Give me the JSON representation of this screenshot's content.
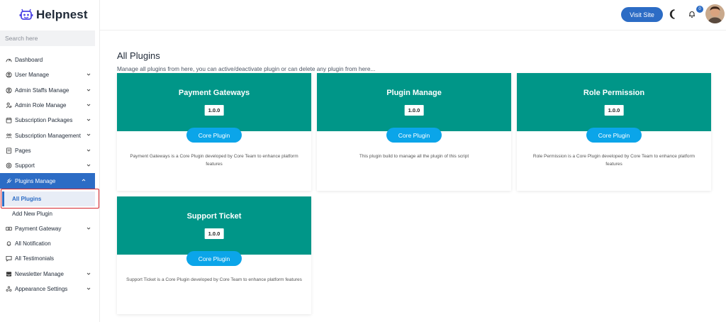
{
  "brand": {
    "name": "Helpnest"
  },
  "search": {
    "placeholder": "Search here"
  },
  "sidebar": {
    "items": [
      {
        "label": "Dashboard",
        "icon": "dashboard-icon",
        "chevron": false
      },
      {
        "label": "User Manage",
        "icon": "user-icon",
        "chevron": true
      },
      {
        "label": "Admin Staffs Manage",
        "icon": "user-circle-icon",
        "chevron": true
      },
      {
        "label": "Admin Role Manage",
        "icon": "role-icon",
        "chevron": true
      },
      {
        "label": "Subscription Packages",
        "icon": "calendar-icon",
        "chevron": true
      },
      {
        "label": "Subscription Management",
        "icon": "users-icon",
        "chevron": true
      },
      {
        "label": "Pages",
        "icon": "page-icon",
        "chevron": true
      },
      {
        "label": "Support",
        "icon": "support-icon",
        "chevron": true
      },
      {
        "label": "Plugins Manage",
        "icon": "plug-icon",
        "chevron": true,
        "active": true
      }
    ],
    "subitems": [
      {
        "label": "All Plugins",
        "selected": true
      },
      {
        "label": "Add New Plugin"
      }
    ],
    "items_after": [
      {
        "label": "Payment Gateway",
        "icon": "money-icon",
        "chevron": true
      },
      {
        "label": "All Notification",
        "icon": "bell-icon",
        "chevron": false
      },
      {
        "label": "All Testimonials",
        "icon": "chat-icon",
        "chevron": false
      },
      {
        "label": "Newsletter Manage",
        "icon": "inbox-icon",
        "chevron": true
      },
      {
        "label": "Appearance Settings",
        "icon": "appearance-icon",
        "chevron": true
      }
    ]
  },
  "header": {
    "visit_label": "Visit Site",
    "notification_count": "0"
  },
  "main": {
    "title": "All Plugins",
    "subtitle": "Manage all plugins from here, you can active/deactivate plugin or can delete any plugin from here...",
    "cards": [
      {
        "title": "Payment Gateways",
        "version": "1.0.0",
        "button": "Core Plugin",
        "description": "Payment Gateways is a Core Plugin developed by Core Team to enhance platform features"
      },
      {
        "title": "Plugin Manage",
        "version": "1.0.0",
        "button": "Core Plugin",
        "description": "This plugin build to manage all the plugin of this script"
      },
      {
        "title": "Role Permission",
        "version": "1.0.0",
        "button": "Core Plugin",
        "description": "Role Permission is a Core Plugin developed by Core Team to enhance platform features"
      },
      {
        "title": "Support Ticket",
        "version": "1.0.0",
        "button": "Core Plugin",
        "description": "Support Ticket is a Core Plugin developed by Core Team to enhance platform features"
      }
    ]
  },
  "colors": {
    "accent": "#2c6cc5",
    "card_header": "#009688",
    "core_button": "#0ba5e9",
    "highlight": "#d6262d"
  }
}
